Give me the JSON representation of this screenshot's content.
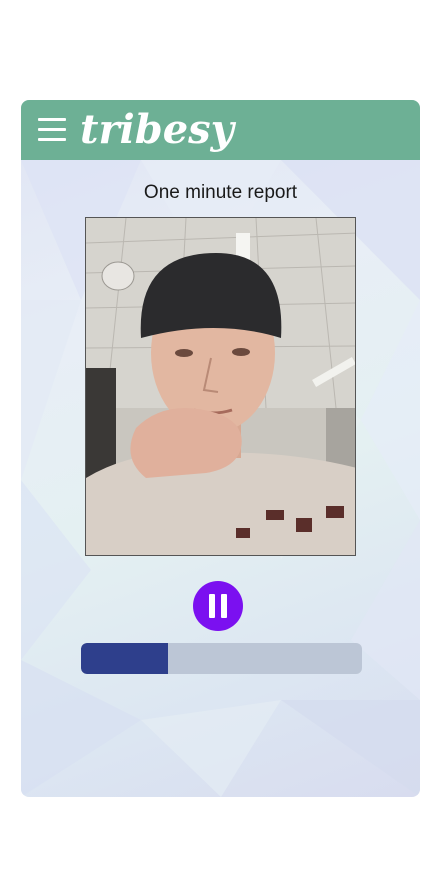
{
  "header": {
    "brand": "tribesy",
    "background_color": "#6db095",
    "menu_icon": "hamburger-menu-icon"
  },
  "report": {
    "title": "One minute report",
    "video_description_icon": "video-preview",
    "progress_fraction": 0.31,
    "progress_color": "#2e3f8c",
    "track_color": "#bcc6d6"
  },
  "controls": {
    "pause_icon": "pause-icon",
    "pause_button_color": "#7b10f0"
  }
}
